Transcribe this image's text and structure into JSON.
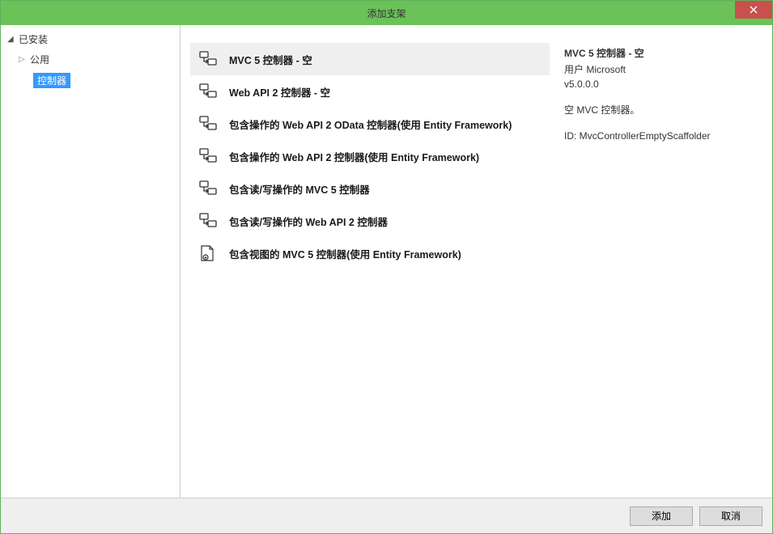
{
  "window": {
    "title": "添加支架"
  },
  "sidebar": {
    "installed_label": "已安装",
    "common_label": "公用",
    "controller_label": "控制器"
  },
  "scaffolds": [
    {
      "label": "MVC 5 控制器 - 空",
      "icon": "controller",
      "selected": true
    },
    {
      "label": "Web API 2 控制器 - 空",
      "icon": "controller",
      "selected": false
    },
    {
      "label": "包含操作的 Web API 2 OData 控制器(使用 Entity Framework)",
      "icon": "controller",
      "selected": false
    },
    {
      "label": "包含操作的 Web API 2 控制器(使用 Entity Framework)",
      "icon": "controller",
      "selected": false
    },
    {
      "label": "包含读/写操作的 MVC 5 控制器",
      "icon": "controller",
      "selected": false
    },
    {
      "label": "包含读/写操作的 Web API 2 控制器",
      "icon": "controller",
      "selected": false
    },
    {
      "label": "包含视图的 MVC 5 控制器(使用 Entity Framework)",
      "icon": "controller-view",
      "selected": false
    }
  ],
  "details": {
    "title": "MVC 5 控制器 - 空",
    "author_line": "用户 Microsoft",
    "version": "v5.0.0.0",
    "description": "空 MVC 控制器。",
    "id_label": "ID: MvcControllerEmptyScaffolder"
  },
  "footer": {
    "add_label": "添加",
    "cancel_label": "取消"
  }
}
